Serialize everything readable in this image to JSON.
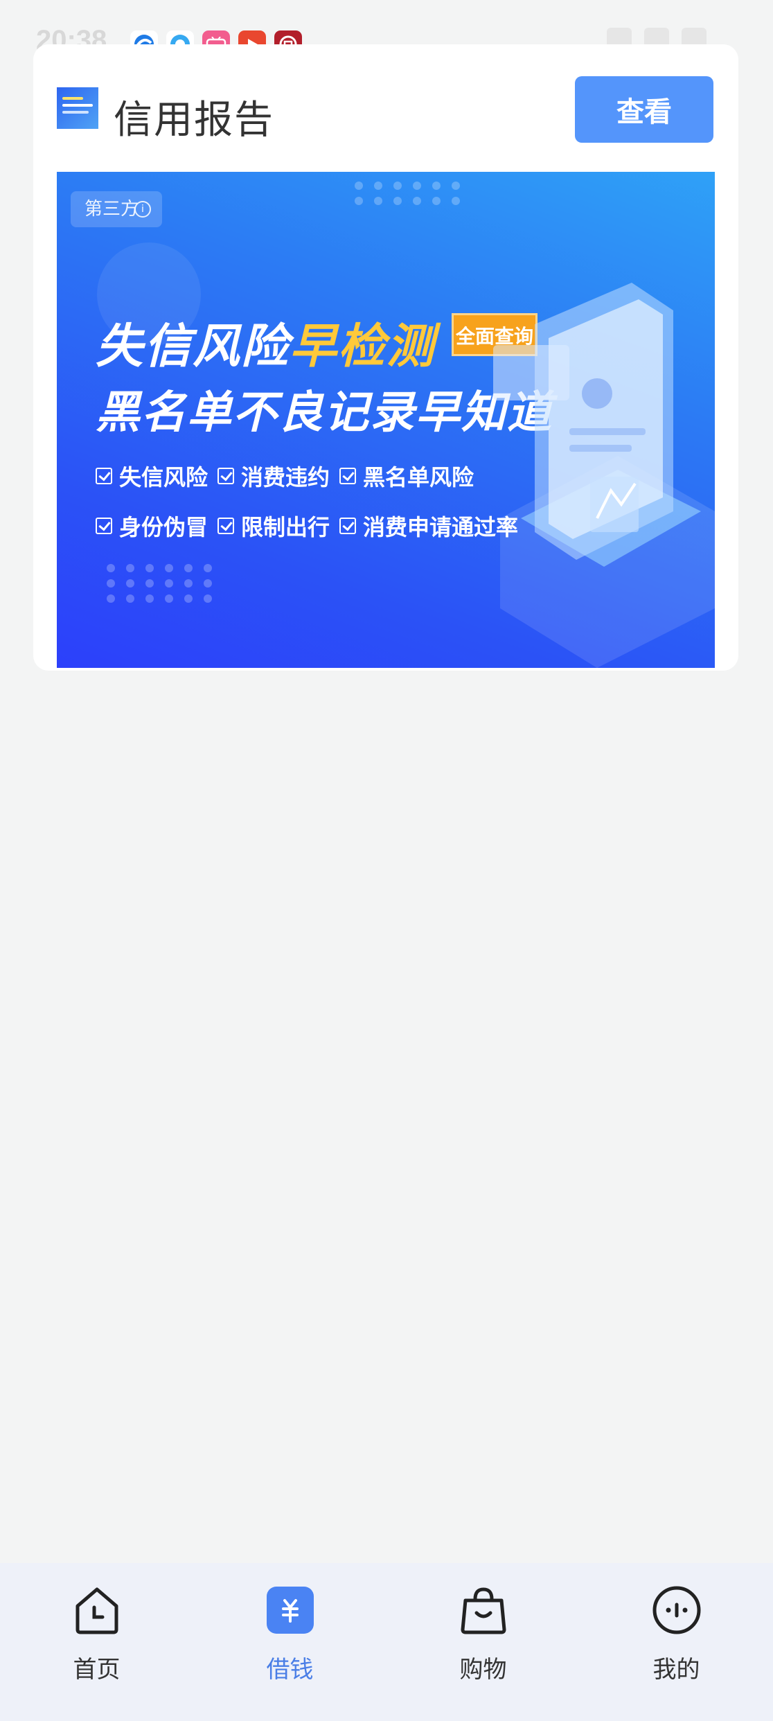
{
  "status_bar": {
    "time": "20:38"
  },
  "card": {
    "title": "信用报告",
    "view_button": "查看",
    "banner": {
      "tag": "第三方",
      "headline_prefix": "失信风险",
      "headline_highlight": "早检测",
      "badge": "全面查询",
      "subheadline": "黑名单不良记录早知道",
      "features": [
        "失信风险",
        "消费违约",
        "黑名单风险",
        "身份伪冒",
        "限制出行",
        "消费申请通过率"
      ]
    }
  },
  "bottom_nav": {
    "items": [
      {
        "label": "首页",
        "icon": "home-icon",
        "active": false
      },
      {
        "label": "借钱",
        "icon": "loan-icon",
        "active": true
      },
      {
        "label": "购物",
        "icon": "shopping-bag-icon",
        "active": false
      },
      {
        "label": "我的",
        "icon": "profile-chat-icon",
        "active": false
      }
    ]
  }
}
